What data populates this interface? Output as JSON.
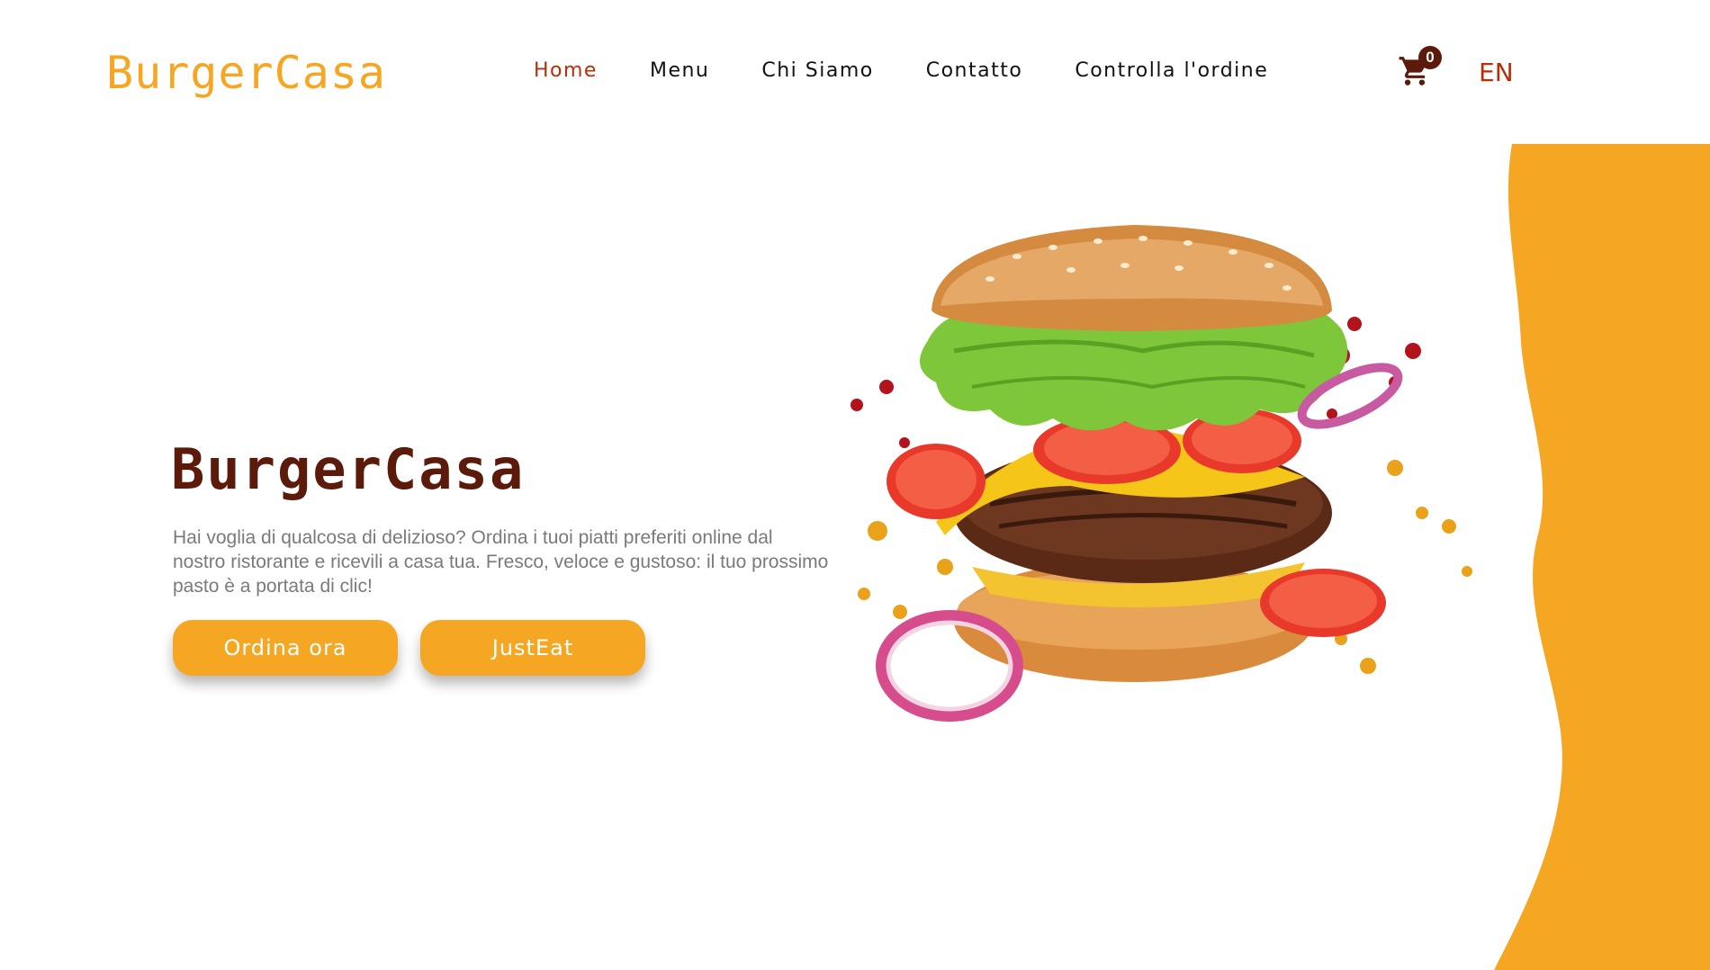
{
  "header": {
    "logo": "BurgerCasa",
    "nav": [
      {
        "label": "Home",
        "active": true
      },
      {
        "label": "Menu",
        "active": false
      },
      {
        "label": "Chi Siamo",
        "active": false
      },
      {
        "label": "Contatto",
        "active": false
      },
      {
        "label": "Controlla l'ordine",
        "active": false
      }
    ],
    "cart": {
      "icon": "cart-icon",
      "count": "0"
    },
    "language": "EN"
  },
  "hero": {
    "title": "BurgerCasa",
    "description": "Hai voglia di qualcosa di delizioso? Ordina i tuoi piatti preferiti online dal nostro ristorante e ricevili a casa tua. Fresco, veloce e gustoso: il tuo prossimo pasto è a portata di clic!",
    "buttons": {
      "order": "Ordina ora",
      "justeat": "JustEat"
    },
    "image": "burger-illustration"
  },
  "colors": {
    "accent": "#f5a623",
    "title": "#5c1a0a",
    "nav_active": "#b5300a",
    "text_muted": "#7a7a7a"
  }
}
